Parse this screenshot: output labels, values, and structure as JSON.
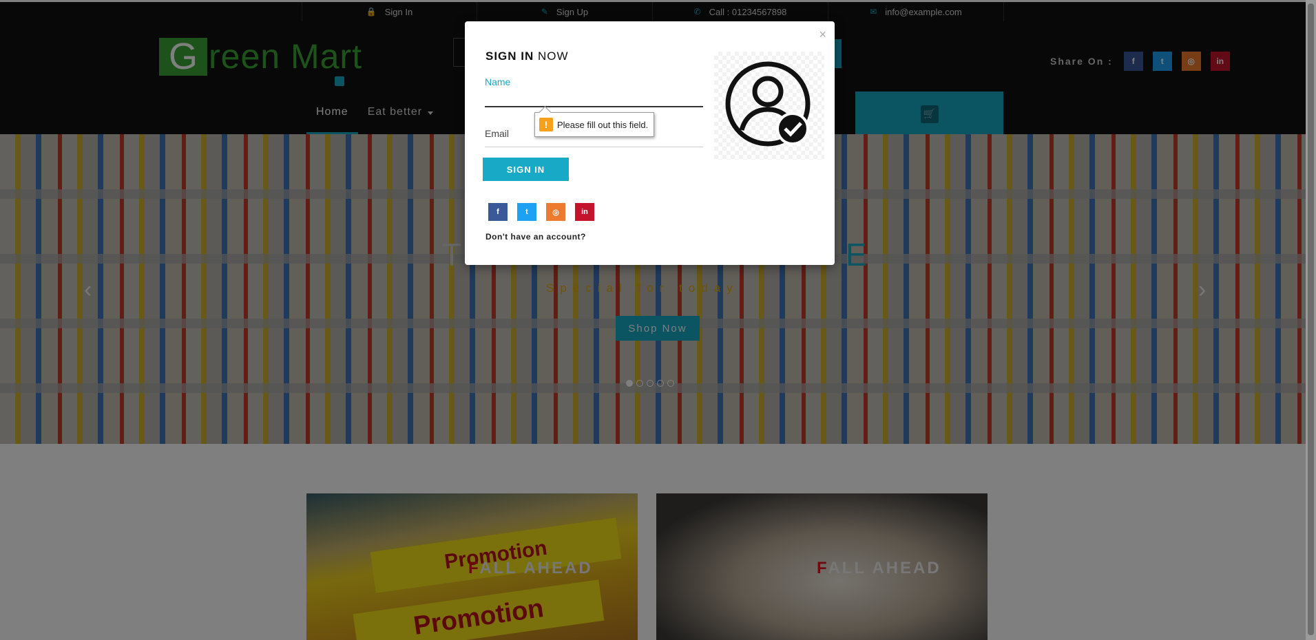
{
  "topbar": {
    "sign_in": "Sign In",
    "sign_up": "Sign Up",
    "call": "Call : 01234567898",
    "email": "info@example.com"
  },
  "logo": {
    "first_letter": "G",
    "rest": "reen Mart"
  },
  "share": {
    "label": "Share On :",
    "icons": [
      "facebook-icon",
      "twitter-icon",
      "instagram-icon",
      "linkedin-icon"
    ]
  },
  "nav": {
    "items": [
      {
        "label": "Home",
        "active": true
      },
      {
        "label": "Eat better",
        "dropdown": true
      }
    ]
  },
  "hero": {
    "title_start": "T",
    "title_end": "E",
    "subtitle": "Special for today",
    "button": "Shop Now",
    "slides": 5,
    "active_slide": 1
  },
  "promos": [
    {
      "sign_top": "Promotion",
      "sign_bottom": "Promotion",
      "label_first": "F",
      "label_rest": "ALL AHEAD"
    },
    {
      "label_first": "F",
      "label_rest": "ALL AHEAD"
    }
  ],
  "modal": {
    "close": "×",
    "title_bold": "SIGN IN",
    "title_rest": "NOW",
    "name_label": "Name",
    "email_label": "Email",
    "name_value": "",
    "email_value": "",
    "validation_message": "Please fill out this field.",
    "submit": "SIGN IN",
    "no_account": "Don't have an account?",
    "social_icons": [
      "facebook-icon",
      "twitter-icon",
      "instagram-icon",
      "linkedin-icon"
    ]
  },
  "colors": {
    "accent": "#17a9c5",
    "brand_green": "#3aa635",
    "header_bg": "#111111",
    "facebook": "#3b5998",
    "twitter": "#1da1f2",
    "instagram": "#ed7a2f",
    "linkedin": "#c4142c",
    "warning": "#f7a11b"
  }
}
